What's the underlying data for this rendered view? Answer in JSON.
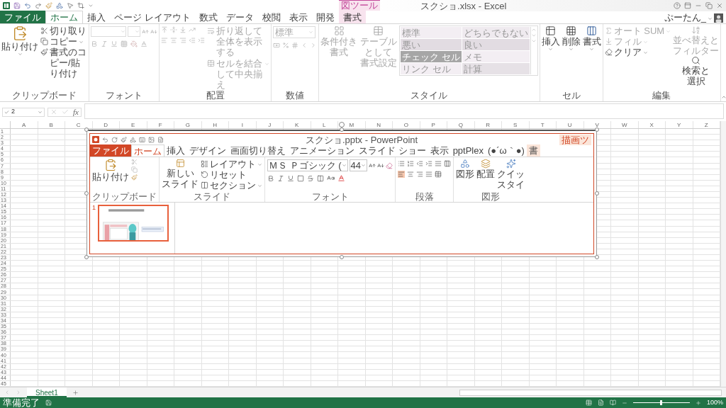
{
  "title_bar": {
    "title": "スクショ.xlsx - Excel",
    "context_label": "図ツール"
  },
  "tabs": [
    {
      "label": "ファイル",
      "kind": "file",
      "selected": false
    },
    {
      "label": "ホーム",
      "kind": "normal",
      "selected": true
    },
    {
      "label": "挿入",
      "kind": "normal",
      "selected": false
    },
    {
      "label": "ページ レイアウト",
      "kind": "normal",
      "selected": false
    },
    {
      "label": "数式",
      "kind": "normal",
      "selected": false
    },
    {
      "label": "データ",
      "kind": "normal",
      "selected": false
    },
    {
      "label": "校閲",
      "kind": "normal",
      "selected": false
    },
    {
      "label": "表示",
      "kind": "normal",
      "selected": false
    },
    {
      "label": "開発",
      "kind": "normal",
      "selected": false
    },
    {
      "label": "書式",
      "kind": "contextual",
      "selected": false
    }
  ],
  "account": {
    "user": "ぷーたん_"
  },
  "clipboard": {
    "label": "クリップボード",
    "paste": "貼り付け",
    "cut": "切り取り",
    "copy": "コピー",
    "format_painter": "書式のコピー/貼り付け"
  },
  "font": {
    "label": "フォント",
    "disabled": true
  },
  "alignment": {
    "label": "配置",
    "disabled": true,
    "wrap": "折り返して全体を表示する",
    "merge": "セルを結合して中央揃え"
  },
  "number": {
    "label": "数値",
    "disabled": true,
    "format": "標準"
  },
  "styles": {
    "label": "スタイル",
    "disabled": true,
    "conditional": [
      "条件付き",
      "書式"
    ],
    "table": [
      "テーブルとして",
      "書式設定"
    ],
    "gallery": [
      {
        "label": "標準",
        "color": "#f3eef3"
      },
      {
        "label": "どちらでもない",
        "color": "#efeaef"
      },
      {
        "label": "悪い",
        "color": "#e2dce2"
      },
      {
        "label": "良い",
        "color": "#e2dce2"
      },
      {
        "label": "チェック セル",
        "color": "#a6a6a6"
      },
      {
        "label": "メモ",
        "color": "#f3eef3"
      },
      {
        "label": "リンク セル",
        "color": "#f3eef3"
      },
      {
        "label": "計算",
        "color": "#e6e1e6"
      }
    ]
  },
  "cells": {
    "label": "セル",
    "insert": "挿入",
    "delete": "削除",
    "format": "書式"
  },
  "editing": {
    "label": "編集",
    "autosum": "オート SUM",
    "fill": "フィル",
    "clear": "クリア",
    "sort": [
      "並べ替えと",
      "フィルター"
    ],
    "find": [
      "検索と",
      "選択"
    ]
  },
  "formula_bar": {
    "name_box": "2",
    "function_label": "fx"
  },
  "grid": {
    "columns": [
      "A",
      "B",
      "C",
      "D",
      "E",
      "F",
      "G",
      "H",
      "I",
      "J",
      "K",
      "L",
      "M",
      "N",
      "O",
      "P",
      "Q",
      "R",
      "S",
      "T",
      "U",
      "V",
      "W",
      "X",
      "Y",
      "Z"
    ],
    "rows": [
      "1",
      "2",
      "3",
      "4",
      "5",
      "6",
      "7",
      "8",
      "9",
      "10",
      "11",
      "12",
      "13",
      "14",
      "15",
      "16",
      "17",
      "18",
      "19",
      "20",
      "21",
      "22",
      "23",
      "24",
      "25",
      "26",
      "27",
      "28",
      "29",
      "30",
      "31",
      "32",
      "33",
      "34",
      "35",
      "36",
      "37",
      "38",
      "39",
      "40",
      "41",
      "42",
      "43",
      "44",
      "45"
    ]
  },
  "powerpoint": {
    "title": "スクショ.pptx - PowerPoint",
    "context_label": "描画ツ",
    "tabs": [
      {
        "label": "ファイル",
        "kind": "file",
        "selected": false
      },
      {
        "label": "ホーム",
        "kind": "normal",
        "selected": true
      },
      {
        "label": "挿入",
        "kind": "normal",
        "selected": false
      },
      {
        "label": "デザイン",
        "kind": "normal",
        "selected": false
      },
      {
        "label": "画面切り替え",
        "kind": "normal",
        "selected": false
      },
      {
        "label": "アニメーション",
        "kind": "normal",
        "selected": false
      },
      {
        "label": "スライド ショー",
        "kind": "normal",
        "selected": false
      },
      {
        "label": "表示",
        "kind": "normal",
        "selected": false
      },
      {
        "label": "pptPlex",
        "kind": "normal",
        "selected": false
      },
      {
        "label": "(●´ω｀●)",
        "kind": "normal",
        "selected": false
      },
      {
        "label": "書",
        "kind": "contextual",
        "selected": false
      }
    ],
    "clipboard": {
      "label": "クリップボード",
      "paste": "貼り付け"
    },
    "slides": {
      "label": "スライド",
      "new_slide": [
        "新しい",
        "スライド"
      ],
      "layout": "レイアウト",
      "reset": "リセット",
      "section": "セクション"
    },
    "font": {
      "label": "フォント",
      "name": "ＭＳ Ｐゴシック (",
      "size": "44"
    },
    "paragraph": {
      "label": "段落"
    },
    "drawing": {
      "label": "図形",
      "shapes": "図形",
      "arrange": "配置",
      "quick_styles": [
        "クイッ",
        "スタイ"
      ]
    },
    "slide_list": [
      {
        "number": "1",
        "selected": true
      }
    ]
  },
  "sheet_tabs": [
    {
      "label": "Sheet1",
      "selected": true
    }
  ],
  "status_bar": {
    "status": "準備完了",
    "zoom": "100%",
    "zoom_slider": {
      "level": 0.5
    }
  }
}
